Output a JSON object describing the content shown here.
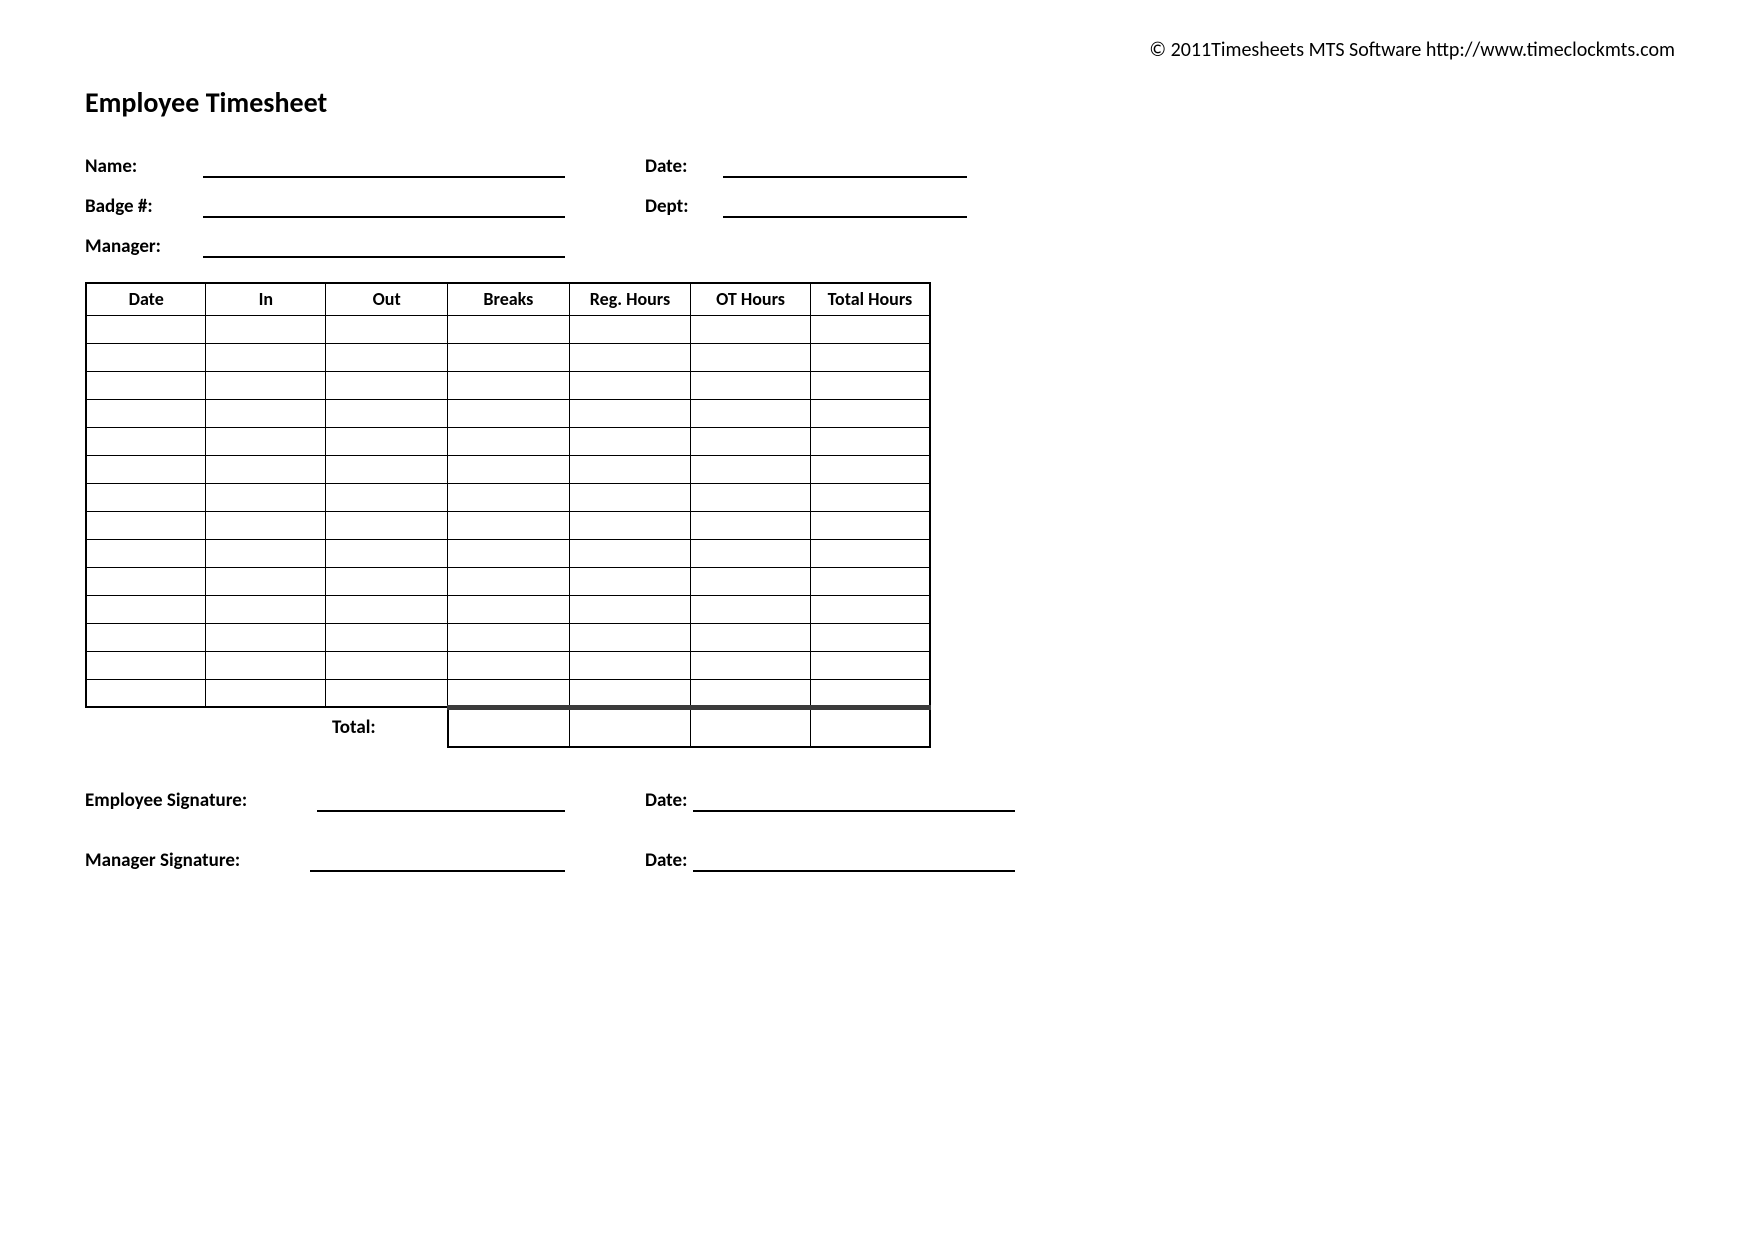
{
  "copyright": "© 2011Timesheets MTS Software  http://www.timeclockmts.com",
  "title": "Employee Timesheet",
  "info": {
    "name_label": "Name:",
    "badge_label": "Badge #:",
    "manager_label": "Manager:",
    "date_label": "Date:",
    "dept_label": "Dept:"
  },
  "table": {
    "headers": [
      "Date",
      "In",
      "Out",
      "Breaks",
      "Reg. Hours",
      "OT Hours",
      "Total Hours"
    ],
    "row_count": 14,
    "total_label": "Total:"
  },
  "signatures": {
    "employee_label": "Employee Signature:",
    "manager_label": "Manager Signature:",
    "date_label": "Date:"
  }
}
